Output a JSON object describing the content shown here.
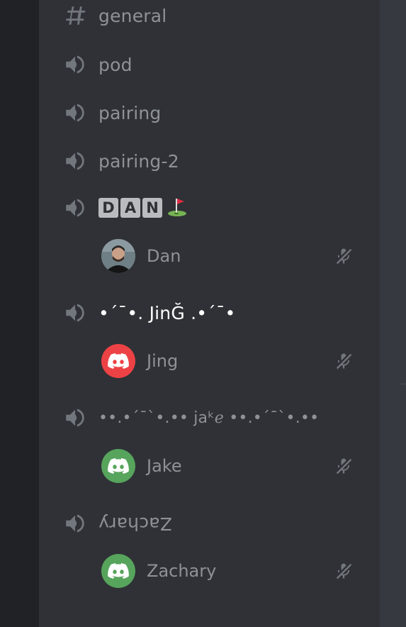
{
  "channels": [
    {
      "name": "general",
      "type": "text"
    },
    {
      "name": "pod",
      "type": "voice"
    },
    {
      "name": "pairing",
      "type": "voice"
    },
    {
      "name": "pairing-2",
      "type": "voice"
    },
    {
      "name": "🇩🇦🇳⛳",
      "badge_letters": [
        "D",
        "A",
        "N"
      ],
      "emoji": "⛳",
      "type": "voice"
    },
    {
      "name": "•´¯•. JinĞ .•´¯•",
      "type": "voice"
    },
    {
      "name": "••.•´¯`•.•• jaᵏℯ ••.•´¯`•.••",
      "type": "voice"
    },
    {
      "name": "Zachary",
      "type": "voice",
      "rendered": "upside-down"
    }
  ],
  "members": [
    {
      "name": "Dan",
      "avatar": "photo",
      "status_icon": "mic-muted-icon"
    },
    {
      "name": "Jing",
      "avatar": "discord-logo-red",
      "avatar_color": "#ed4245",
      "status_icon": "mic-muted-icon"
    },
    {
      "name": "Jake",
      "avatar": "discord-logo-green",
      "avatar_color": "#57a45c",
      "status_icon": "mic-muted-icon"
    },
    {
      "name": "Zachary",
      "avatar": "discord-logo-green",
      "avatar_color": "#57a45c",
      "status_icon": "mic-muted-icon"
    }
  ],
  "colors": {
    "sidebar_bg": "#2f3136",
    "guild_bg": "#202225",
    "main_bg": "#36393f",
    "muted_text": "#8e9297",
    "bright_text": "#ffffff"
  }
}
